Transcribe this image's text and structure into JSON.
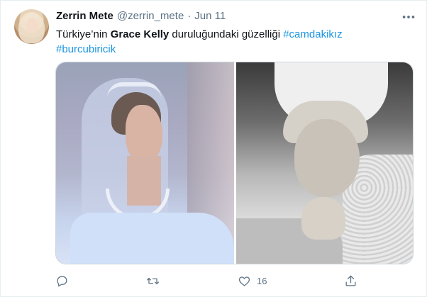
{
  "author": {
    "name": "Zerrin Mete",
    "handle": "@zerrin_mete",
    "separator": "·",
    "time": "Jun 11"
  },
  "tweet": {
    "text_part1": "Türkiye’nin ",
    "text_bold": "Grace Kelly",
    "text_part2": " duruluğundaki güzelliği ",
    "hashtag1": "#camdakikız",
    "hashtag2": "#burcubiricik"
  },
  "media": {
    "count": 2,
    "left_photo_tone": "color",
    "right_photo_tone": "black-and-white"
  },
  "actions": {
    "reply_icon": "reply-icon",
    "retweet_icon": "retweet-icon",
    "like_icon": "heart-icon",
    "like_count": "16",
    "share_icon": "share-icon"
  },
  "more_icon": "more-icon",
  "colors": {
    "hashtag": "#1b95e0",
    "secondary_text": "#5b7083",
    "primary_text": "#0f1419",
    "border": "#e6ecf0"
  }
}
